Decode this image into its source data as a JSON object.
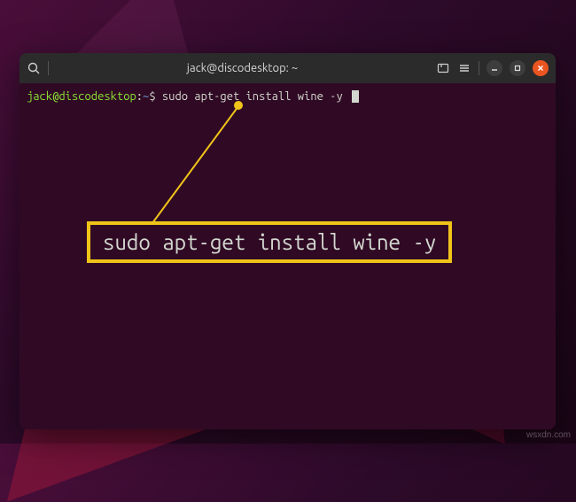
{
  "titlebar": {
    "title": "jack@discodesktop: ~"
  },
  "prompt": {
    "user": "jack@discodesktop",
    "sep": ":",
    "dir": "~",
    "sym": "$",
    "command": " sudo apt-get install wine -y "
  },
  "callout": {
    "text": "sudo apt-get install wine -y"
  },
  "watermark": "wsxdn.com"
}
